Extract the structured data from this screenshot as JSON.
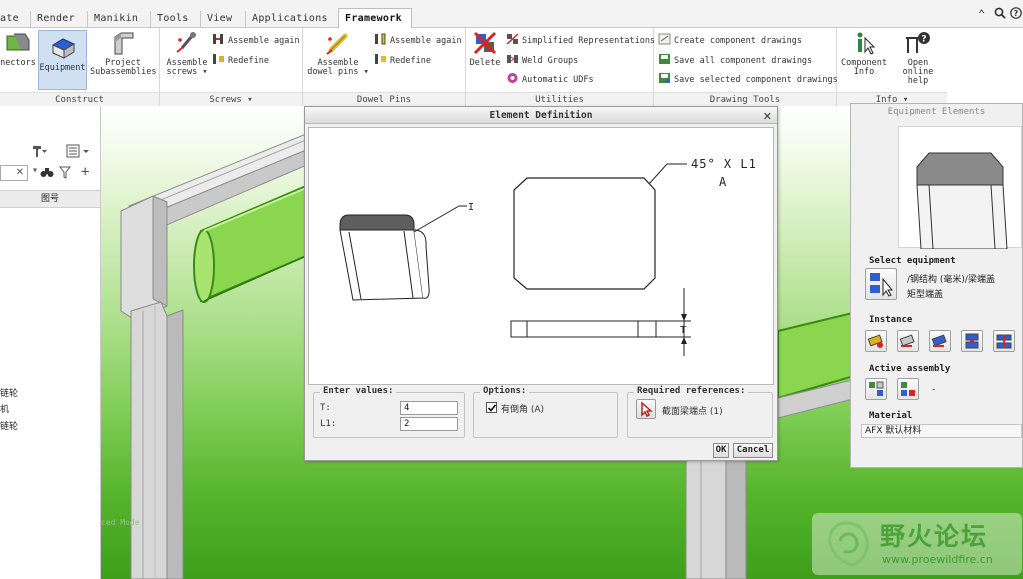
{
  "tabs": [
    "ate",
    "Render",
    "Manikin",
    "Tools",
    "View",
    "Applications",
    "Framework"
  ],
  "active_tab": "Framework",
  "ribbon": {
    "construct": {
      "label": "Construct",
      "connectors": "nectors",
      "equipment": "Equipment",
      "project_sub_1": "Project",
      "project_sub_2": "Subassemblies"
    },
    "screws": {
      "label": "Screws ▾",
      "assemble_1": "Assemble",
      "assemble_2": "screws ▾",
      "assemble_again": "Assemble again",
      "redefine": "Redefine"
    },
    "dowel": {
      "label": "Dowel Pins",
      "assemble_1": "Assemble",
      "assemble_2": "dowel pins ▾",
      "assemble_again": "Assemble again",
      "redefine": "Redefine"
    },
    "utilities": {
      "label": "Utilities",
      "delete": "Delete",
      "simplified": "Simplified Representations",
      "weld": "Weld Groups",
      "udfs": "Automatic UDFs"
    },
    "drawing": {
      "label": "Drawing Tools",
      "create": "Create component drawings",
      "save_all": "Save all component drawings",
      "save_sel": "Save selected component drawings"
    },
    "info": {
      "label": "Info ▾",
      "component_1": "Component",
      "component_2": "Info",
      "online_1": "Open online",
      "online_2": "help"
    }
  },
  "left_panel": {
    "column_header": "图号",
    "items": [
      "链轮",
      "机",
      "链轮"
    ]
  },
  "viewport": {
    "watermark_left": "ced Mode"
  },
  "dialog": {
    "title": "Element Definition",
    "close": "✕",
    "drawing": {
      "callout_1": "45° X L1",
      "callout_2": "A",
      "leader_label": "I",
      "dim_label": "T"
    },
    "enter_values": {
      "legend": "Enter values:",
      "t_label": "T:",
      "t_value": "4",
      "l1_label": "L1:",
      "l1_value": "2"
    },
    "options": {
      "legend": "Options:",
      "chamfer_label": "有倒角 (A)",
      "chamfer_checked": true
    },
    "required_refs": {
      "legend": "Required references:",
      "ref_label": "截面梁端点 (1)"
    },
    "ok": "OK",
    "cancel": "Cancel"
  },
  "right_panel": {
    "title": "Equipment Elements",
    "select_equipment": "Select equipment",
    "equip_path": "/钢结构 (毫米)/梁端盖",
    "equip_name": "矩型端盖",
    "instance": "Instance",
    "active_assembly": "Active assembly",
    "active_value": "-",
    "material": "Material",
    "material_value": "AFX 默认材料"
  },
  "watermark": {
    "brand": "野火论坛",
    "url": "www.proewildfire.cn"
  },
  "colors": {
    "viewport_green": "#56b52c",
    "selection_green": "#8bd64f",
    "ribbon_select": "#cfe0f3",
    "watermark_green": "#4aa33a"
  }
}
